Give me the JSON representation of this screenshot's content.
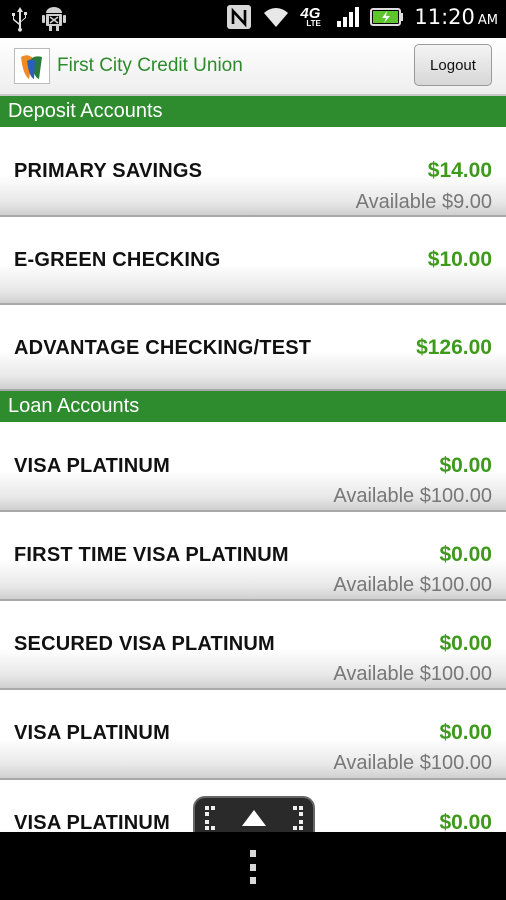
{
  "status_bar": {
    "time": "11:20",
    "ampm": "AM",
    "network_type": "4G",
    "network_sub": "LTE",
    "icons": [
      "usb-icon",
      "android-debug-icon",
      "nfc-icon",
      "wifi-icon",
      "signal-icon",
      "battery-charging-icon"
    ]
  },
  "header": {
    "title": "First City Credit Union",
    "logout_label": "Logout"
  },
  "sections": [
    {
      "title": "Deposit Accounts",
      "accounts": [
        {
          "name": "PRIMARY SAVINGS",
          "balance": "$14.00",
          "available": "Available $9.00"
        },
        {
          "name": "E-GREEN CHECKING",
          "balance": "$10.00",
          "available": ""
        },
        {
          "name": "ADVANTAGE CHECKING/TEST",
          "balance": "$126.00",
          "available": ""
        }
      ]
    },
    {
      "title": "Loan Accounts",
      "accounts": [
        {
          "name": "VISA PLATINUM",
          "balance": "$0.00",
          "available": "Available $100.00"
        },
        {
          "name": "FIRST TIME VISA PLATINUM",
          "balance": "$0.00",
          "available": "Available $100.00"
        },
        {
          "name": "SECURED VISA PLATINUM",
          "balance": "$0.00",
          "available": "Available $100.00"
        },
        {
          "name": "VISA PLATINUM",
          "balance": "$0.00",
          "available": "Available $100.00"
        },
        {
          "name": "VISA PLATINUM",
          "balance": "$0.00",
          "available": ""
        }
      ]
    }
  ],
  "colors": {
    "section_bg": "#2e8b2e",
    "balance_text": "#3d9a1b",
    "title_text": "#2d8b2b"
  }
}
